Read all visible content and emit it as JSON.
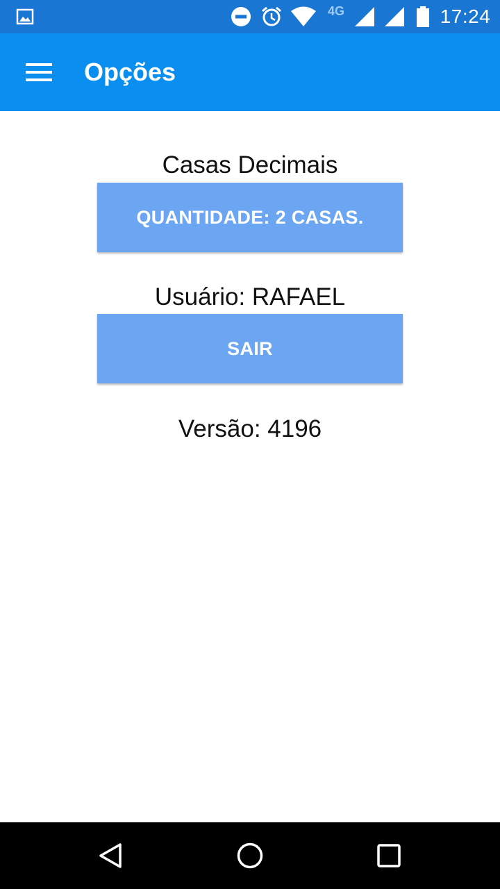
{
  "status_bar": {
    "time": "17:24",
    "network_label": "4G",
    "icons": [
      "image-notification-icon",
      "do-not-disturb-icon",
      "alarm-icon",
      "wifi-icon",
      "signal-icon",
      "signal-icon",
      "battery-icon"
    ]
  },
  "app_bar": {
    "title": "Opções",
    "menu_icon": "hamburger-menu-icon"
  },
  "options": {
    "decimals_label": "Casas Decimais",
    "decimals_button": "QUANTIDADE: 2 CASAS.",
    "user_label": "Usuário: RAFAEL",
    "logout_button": "SAIR",
    "version_label": "Versão: 4196"
  },
  "nav_bar": {
    "icons": [
      "back-icon",
      "home-icon",
      "recents-icon"
    ]
  },
  "colors": {
    "status_bar": "#1976d2",
    "app_bar": "#0a8ff0",
    "button": "#6ca6f2",
    "nav_bar": "#000000"
  }
}
